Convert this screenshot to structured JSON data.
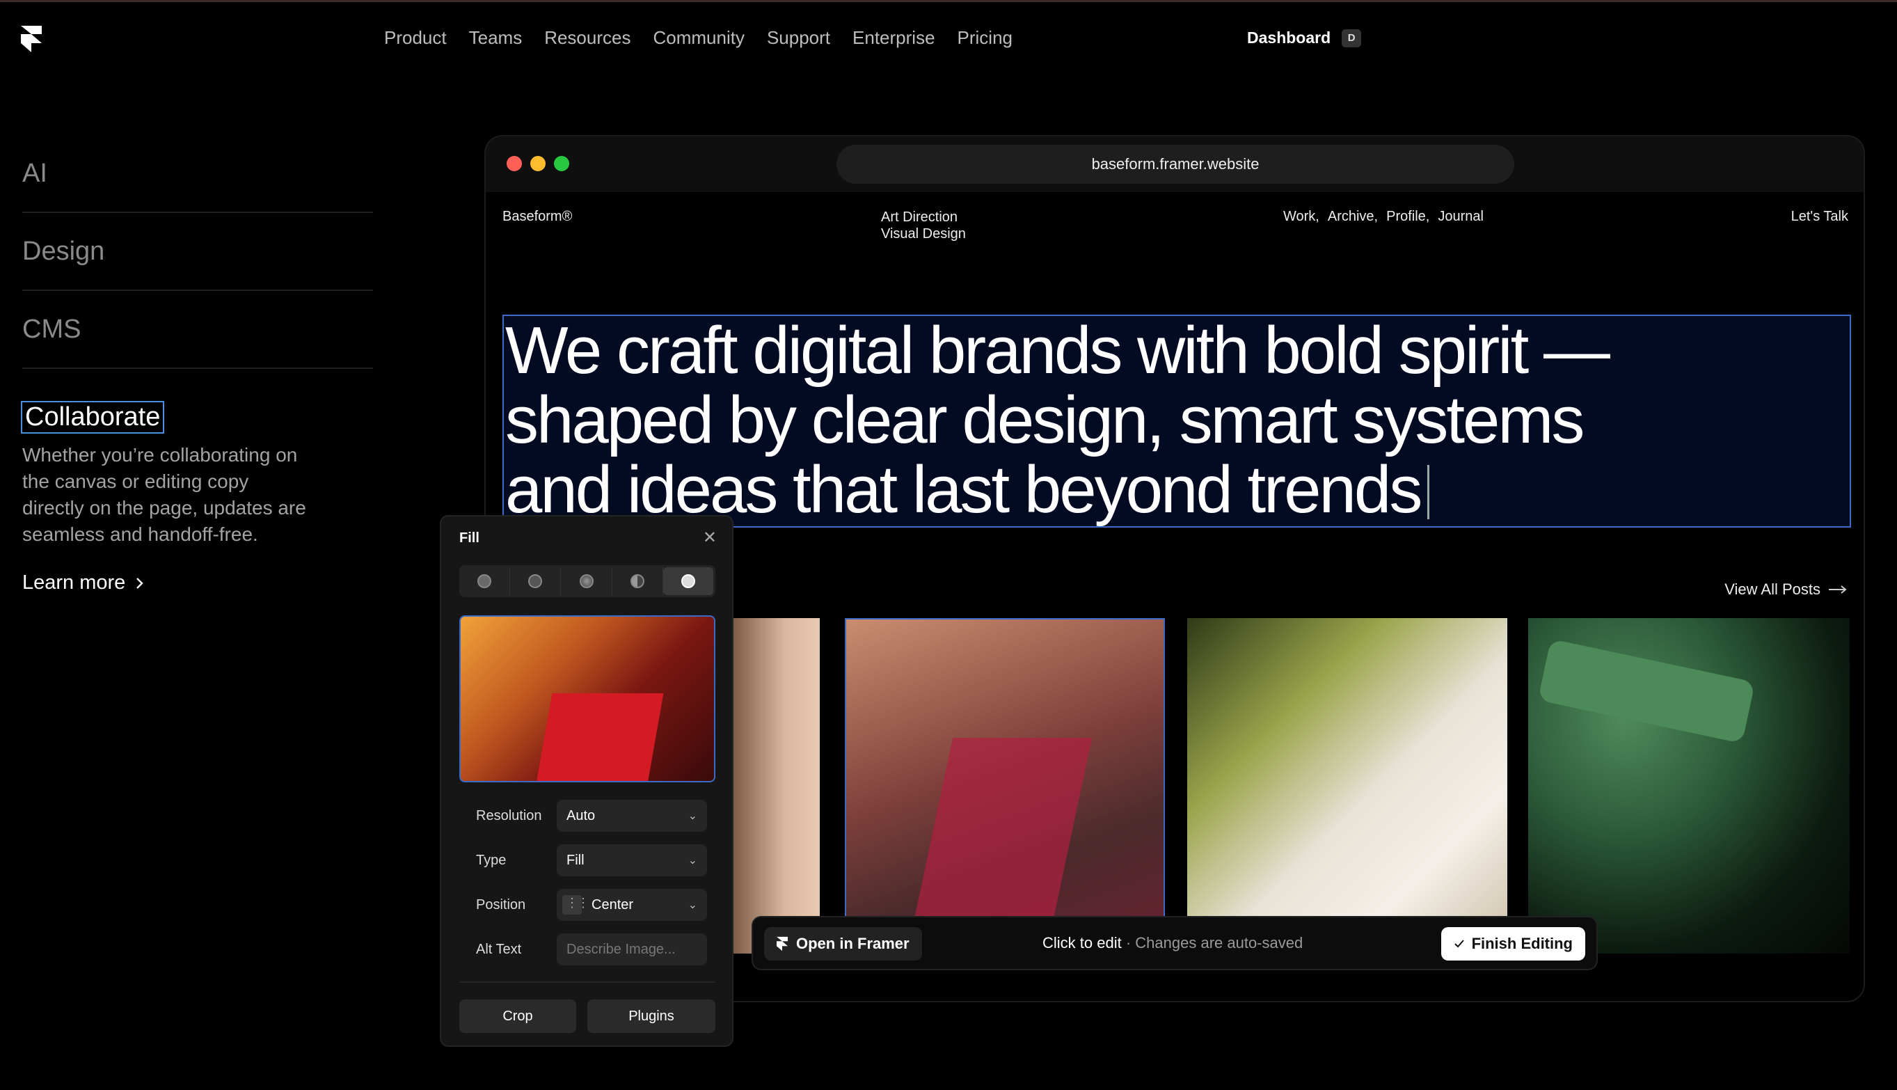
{
  "nav": {
    "items": [
      "Product",
      "Teams",
      "Resources",
      "Community",
      "Support",
      "Enterprise",
      "Pricing"
    ],
    "dashboard_label": "Dashboard",
    "dashboard_shortcut": "D"
  },
  "features": {
    "items": [
      "AI",
      "Design",
      "CMS"
    ],
    "active": {
      "title": "Collaborate",
      "description": "Whether you’re collaborating on the canvas or editing copy directly on the page, updates are seamless and handoff-free.",
      "link_label": "Learn more"
    }
  },
  "browser": {
    "url": "baseform.framer.website",
    "site": {
      "brand": "Baseform®",
      "tagline_1": "Art Direction",
      "tagline_2": "Visual Design",
      "links": [
        "Work,",
        "Archive,",
        "Profile,",
        "Journal"
      ],
      "cta": "Let's Talk",
      "headline_1": "We craft digital brands with bold spirit —",
      "headline_2": "shaped by clear design, smart systems",
      "headline_3": "and ideas that last beyond trends",
      "view_all": "View All Posts"
    }
  },
  "editbar": {
    "open_label": "Open in Framer",
    "hint_main": "Click to edit",
    "hint_sep": " · ",
    "hint_sub": "Changes are auto-saved",
    "finish_label": "Finish Editing"
  },
  "fill_panel": {
    "title": "Fill",
    "resolution_label": "Resolution",
    "resolution_value": "Auto",
    "type_label": "Type",
    "type_value": "Fill",
    "position_label": "Position",
    "position_value": "Center",
    "alt_label": "Alt Text",
    "alt_placeholder": "Describe Image...",
    "crop_label": "Crop",
    "plugins_label": "Plugins"
  },
  "colors": {
    "accent": "#3b6bc7",
    "dot_red": "#ff5f57",
    "dot_yellow": "#febc2e",
    "dot_green": "#28c840"
  }
}
